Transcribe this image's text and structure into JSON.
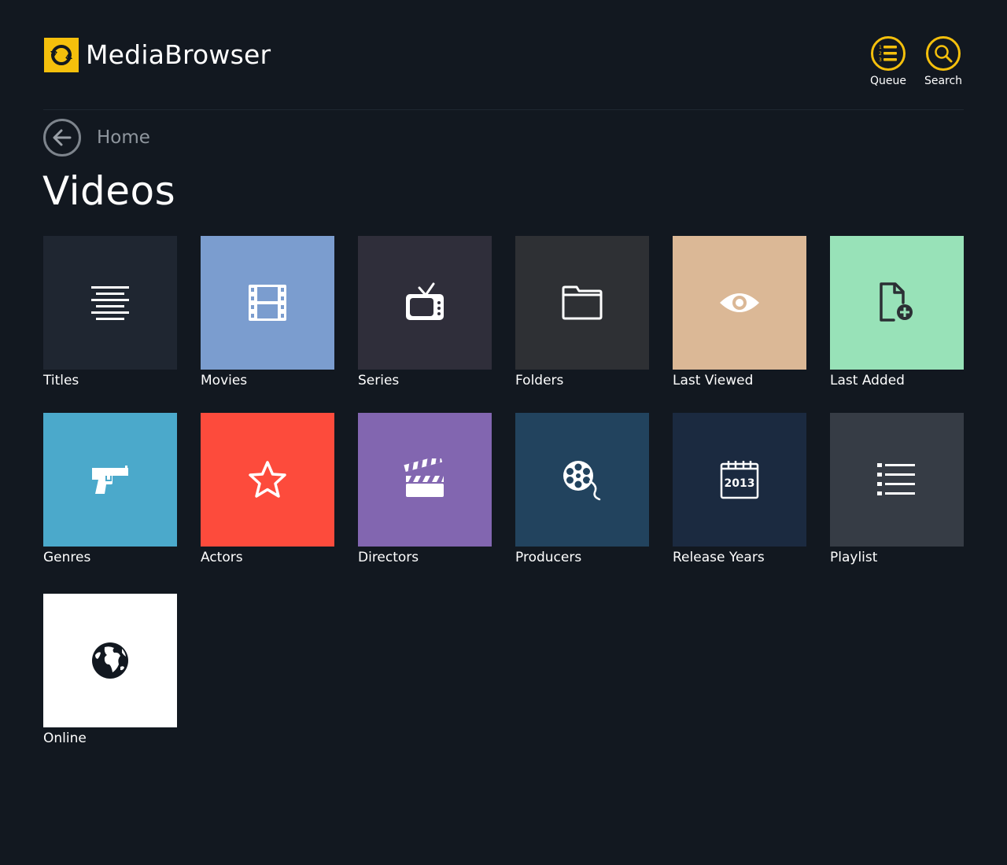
{
  "app": {
    "logo_light": "Media",
    "logo_bold": "Browser",
    "logo_icon": "mediabrowser-logo-icon"
  },
  "header": {
    "queue_label": "Queue",
    "search_label": "Search",
    "accent_color": "#f5c00c"
  },
  "breadcrumb": {
    "label": "Home"
  },
  "page": {
    "title": "Videos"
  },
  "tiles": [
    {
      "label": "Titles",
      "color": "#1f2631",
      "icon": "align-center-icon"
    },
    {
      "label": "Movies",
      "color": "#7b9dcf",
      "icon": "film-strip-icon"
    },
    {
      "label": "Series",
      "color": "#2f2e3a",
      "icon": "tv-icon"
    },
    {
      "label": "Folders",
      "color": "#2e3034",
      "icon": "folder-icon"
    },
    {
      "label": "Last Viewed",
      "color": "#dbb896",
      "icon": "eye-icon"
    },
    {
      "label": "Last Added",
      "color": "#98e2b8",
      "icon": "file-add-icon"
    },
    {
      "label": "Genres",
      "color": "#4ba9cb",
      "icon": "gun-icon"
    },
    {
      "label": "Actors",
      "color": "#fd4b3c",
      "icon": "star-icon"
    },
    {
      "label": "Directors",
      "color": "#8266b0",
      "icon": "clapperboard-icon"
    },
    {
      "label": "Producers",
      "color": "#22435e",
      "icon": "film-reel-icon"
    },
    {
      "label": "Release Years",
      "color": "#1b2a40",
      "icon": "calendar-icon",
      "calendar_year": "2013"
    },
    {
      "label": "Playlist",
      "color": "#363c45",
      "icon": "list-icon"
    },
    {
      "label": "Online",
      "color": "#ffffff",
      "icon": "globe-icon"
    }
  ]
}
